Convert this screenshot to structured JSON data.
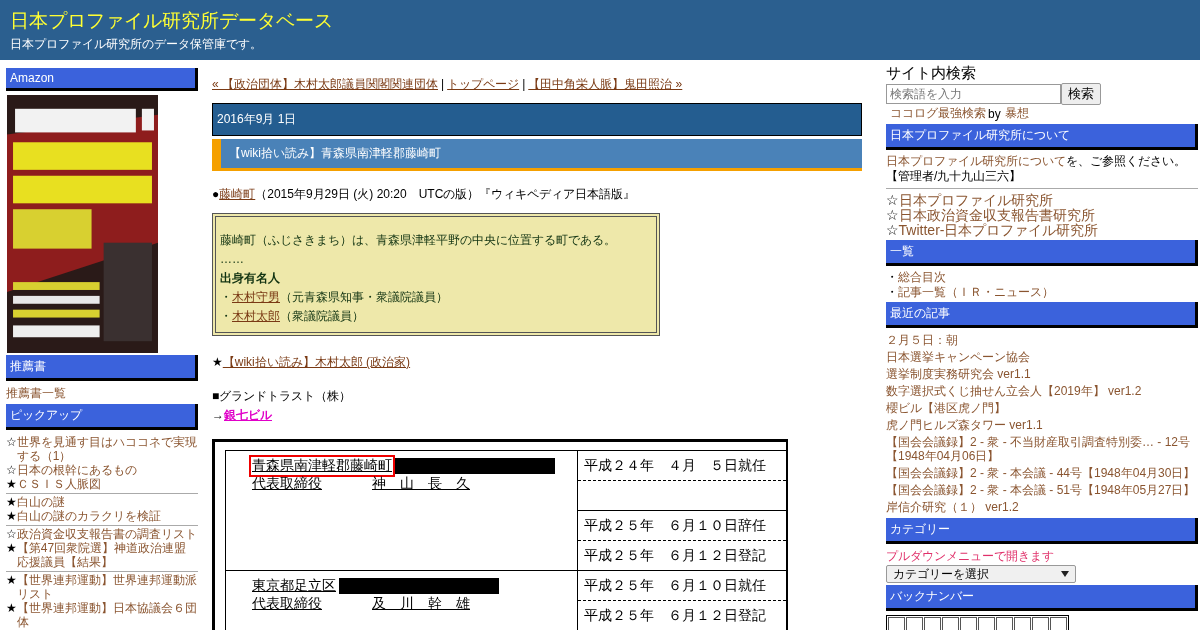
{
  "header": {
    "title": "日本プロファイル研究所データベース",
    "subtitle": "日本プロファイル研究所のデータ保管庫です。"
  },
  "left_sidebar": {
    "amazon": {
      "heading": "Amazon",
      "kind": "picture"
    },
    "recommend": {
      "heading": "推薦書",
      "link": "推薦書一覧"
    },
    "pickup": {
      "heading": "ピックアップ",
      "groups": [
        [
          {
            "mark": "☆",
            "text": "世界を見通す目はハココネで実現する（1）"
          },
          {
            "mark": "☆",
            "text": "日本の根幹にあるもの"
          },
          {
            "mark": "★",
            "text": "ＣＳＩＳ人脈図"
          }
        ],
        [
          {
            "mark": "★",
            "text": "白山の謎"
          },
          {
            "mark": "★",
            "text": "白山の謎のカラクリを検証"
          }
        ],
        [
          {
            "mark": "☆",
            "text": "政治資金収支報告書の調査リスト"
          },
          {
            "mark": "★",
            "text": "【第47回衆院選】神道政治連盟応援議員【結果】"
          }
        ],
        [
          {
            "mark": "★",
            "text": "【世界連邦運動】世界連邦運動派リスト"
          },
          {
            "mark": "★",
            "text": "【世界連邦運動】日本協議会６団体"
          }
        ]
      ]
    }
  },
  "main": {
    "nav": {
      "prev": "« 【政治団体】木村太郎議員関閣関連団体",
      "separator": "|",
      "top": "トップページ",
      "next": "【田中角栄人脈】鬼田照治 »"
    },
    "date": "2016年9月 1日",
    "title": "【wiki拾い読み】青森県南津軽郡藤崎町",
    "source": {
      "bullet": "●",
      "link": "藤崎町",
      "text": "（2015年9月29日 (火) 20:20　UTCの版）『ウィキペディア日本語版』"
    },
    "quote": {
      "text": "藤崎町（ふじさきまち）は、青森県津軽平野の中央に位置する町である。",
      "ellipsis": "……",
      "heading": "出身有名人",
      "people": [
        {
          "bullet": "・",
          "link": "木村守男",
          "note": "（元青森県知事・衆議院議員）"
        },
        {
          "bullet": "・",
          "link": "木村太郎",
          "note": "（衆議院議員）"
        }
      ]
    },
    "related": {
      "mark": "★",
      "link": "【wiki拾い読み】木村太郎 (政治家)"
    },
    "company": {
      "name": "■グランドトラスト（株）",
      "arrow": "→",
      "link": "銀七ビル"
    },
    "document": {
      "rows": [
        {
          "address": "青森県南津軽郡藤崎町",
          "highlighted": true,
          "role": "代表取締役",
          "person": "神　山　長　久",
          "groups": [
            [
              "平成２４年　４月　５日就任"
            ],
            [
              "平成２５年　６月１０日辞任",
              "平成２５年　６月１２日登記"
            ]
          ]
        },
        {
          "address": "東京都足立区",
          "highlighted": false,
          "role": "代表取締役",
          "person": "及　川　幹　雄",
          "groups": [
            [
              "平成２５年　６月１０日就任",
              "平成２５年　６月１２日登記"
            ]
          ]
        }
      ]
    }
  },
  "right_sidebar": {
    "search": {
      "heading": "サイト内検索",
      "placeholder": "検索語を入力",
      "button": "検索",
      "engine": "ココログ最強検索",
      "by": "by",
      "author": "暴想"
    },
    "about": {
      "heading": "日本プロファイル研究所について",
      "link": "日本プロファイル研究所について",
      "text": "を、ご参照ください。",
      "admin": "【管理者/九十九山三六】"
    },
    "sites": [
      {
        "mark": "☆",
        "text": "日本プロファイル研究所"
      },
      {
        "mark": "☆",
        "text": "日本政治資金収支報告書研究所"
      },
      {
        "mark": "☆",
        "text": "Twitter-日本プロファイル研究所"
      }
    ],
    "index": {
      "heading": "一覧",
      "items": [
        {
          "bullet": "・",
          "text": "総合目次"
        },
        {
          "bullet": "・",
          "text": "記事一覧（ＩＲ・ニュース）"
        }
      ]
    },
    "recent": {
      "heading": "最近の記事",
      "items": [
        "２月５日：朝",
        "日本選挙キャンペーン協会",
        "選挙制度実務研究会 ver1.1",
        "数字選択式くじ抽せん立会人【2019年】 ver1.2",
        "櫻ビル【港区虎ノ門】",
        "虎ノ門ヒルズ森タワー ver1.1",
        "【国会会議録】2 - 衆 - 不当財産取引調査特別委… - 12号【1948年04月06日】",
        "【国会会議録】2 - 衆 - 本会議 - 44号【1948年04月30日】",
        "【国会会議録】2 - 衆 - 本会議 - 51号【1948年05月27日】",
        "岸信介研究（１） ver1.2"
      ]
    },
    "category": {
      "heading": "カテゴリー",
      "note": "プルダウンメニューで開きます",
      "select": "カテゴリーを選択"
    },
    "backnumber": {
      "heading": "バックナンバー"
    }
  }
}
